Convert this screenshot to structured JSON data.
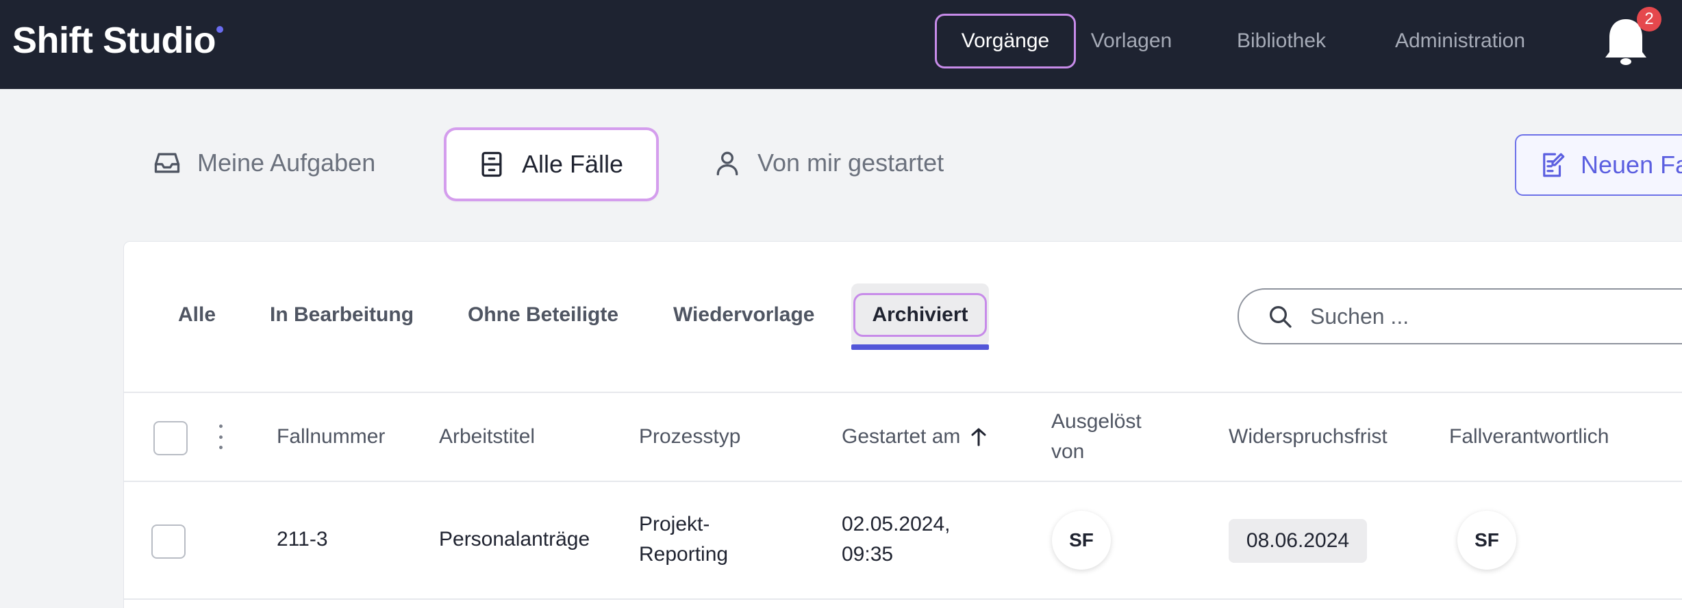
{
  "brand": "Shift Studio",
  "nav": {
    "items": [
      "Vorgänge",
      "Vorlagen",
      "Bibliothek",
      "Administration"
    ],
    "notification_count": "2"
  },
  "views": {
    "my_tasks": "Meine Aufgaben",
    "all_cases": "Alle Fälle",
    "started_by_me": "Von mir gestartet",
    "new_case": "Neuen Fa"
  },
  "filters": {
    "tabs": [
      "Alle",
      "In Bearbeitung",
      "Ohne Beteiligte",
      "Wiedervorlage",
      "Archiviert"
    ],
    "active": "Archiviert"
  },
  "search": {
    "placeholder": "Suchen ..."
  },
  "table": {
    "columns": {
      "case_number": "Fallnummer",
      "working_title": "Arbeitstitel",
      "process_type": "Prozesstyp",
      "started_on": "Gestartet am",
      "triggered_by_1": "Ausgelöst",
      "triggered_by_2": "von",
      "objection_deadline": "Widerspruchsfrist",
      "case_owner": "Fallverantwortlich"
    },
    "rows": [
      {
        "case_number": "211-3",
        "working_title": "Personalanträge",
        "process_type_1": "Projekt-",
        "process_type_2": "Reporting",
        "started_1": "02.05.2024,",
        "started_2": "09:35",
        "triggered_by": "SF",
        "objection_deadline": "08.06.2024",
        "case_owner": "SF"
      }
    ]
  },
  "colors": {
    "topbar": "#1e2331",
    "accent": "#5b5fe0",
    "focus_ring": "#c78be9",
    "badge": "#e5484d"
  }
}
